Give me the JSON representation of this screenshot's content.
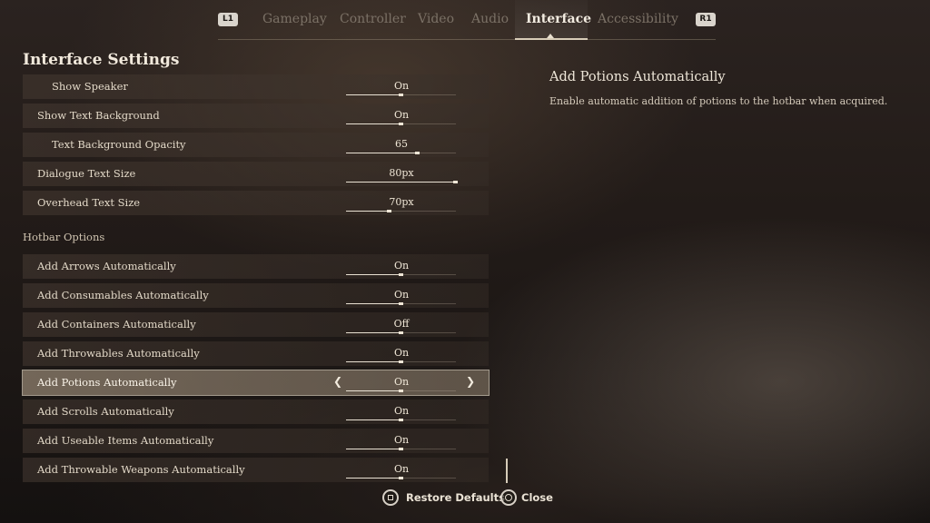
{
  "tabs": {
    "left_button": "L1",
    "right_button": "R1",
    "items": [
      {
        "label": "Gameplay"
      },
      {
        "label": "Controller"
      },
      {
        "label": "Video"
      },
      {
        "label": "Audio"
      },
      {
        "label": "Interface",
        "active": true
      },
      {
        "label": "Accessibility"
      }
    ]
  },
  "panel": {
    "title": "Interface Settings",
    "rows": [
      {
        "label": "Show Speaker",
        "value": "On",
        "indent": true,
        "level": 0.5
      },
      {
        "label": "Show Text Background",
        "value": "On",
        "level": 0.5
      },
      {
        "label": "Text Background Opacity",
        "value": "65",
        "indent": true,
        "level": 0.65
      },
      {
        "label": "Dialogue Text Size",
        "value": "80px",
        "level": 1.0
      },
      {
        "label": "Overhead Text Size",
        "value": "70px",
        "level": 0.4
      },
      {
        "label": "Hotbar Options",
        "header": true
      },
      {
        "label": "Add Arrows Automatically",
        "value": "On",
        "level": 0.5
      },
      {
        "label": "Add Consumables Automatically",
        "value": "On",
        "level": 0.5
      },
      {
        "label": "Add Containers Automatically",
        "value": "Off",
        "level": 0.5
      },
      {
        "label": "Add Throwables Automatically",
        "value": "On",
        "level": 0.5
      },
      {
        "label": "Add Potions Automatically",
        "value": "On",
        "selected": true,
        "level": 0.5
      },
      {
        "label": "Add Scrolls Automatically",
        "value": "On",
        "level": 0.5
      },
      {
        "label": "Add Useable Items Automatically",
        "value": "On",
        "level": 0.5
      },
      {
        "label": "Add Throwable Weapons Automatically",
        "value": "On",
        "level": 0.5
      }
    ]
  },
  "description": {
    "title": "Add Potions Automatically",
    "text": "Enable automatic addition of potions to the hotbar when acquired."
  },
  "footer": {
    "restore": {
      "label": "Restore Defaults",
      "icon": "square-button-icon"
    },
    "close": {
      "label": "Close",
      "icon": "circle-button-icon"
    }
  }
}
